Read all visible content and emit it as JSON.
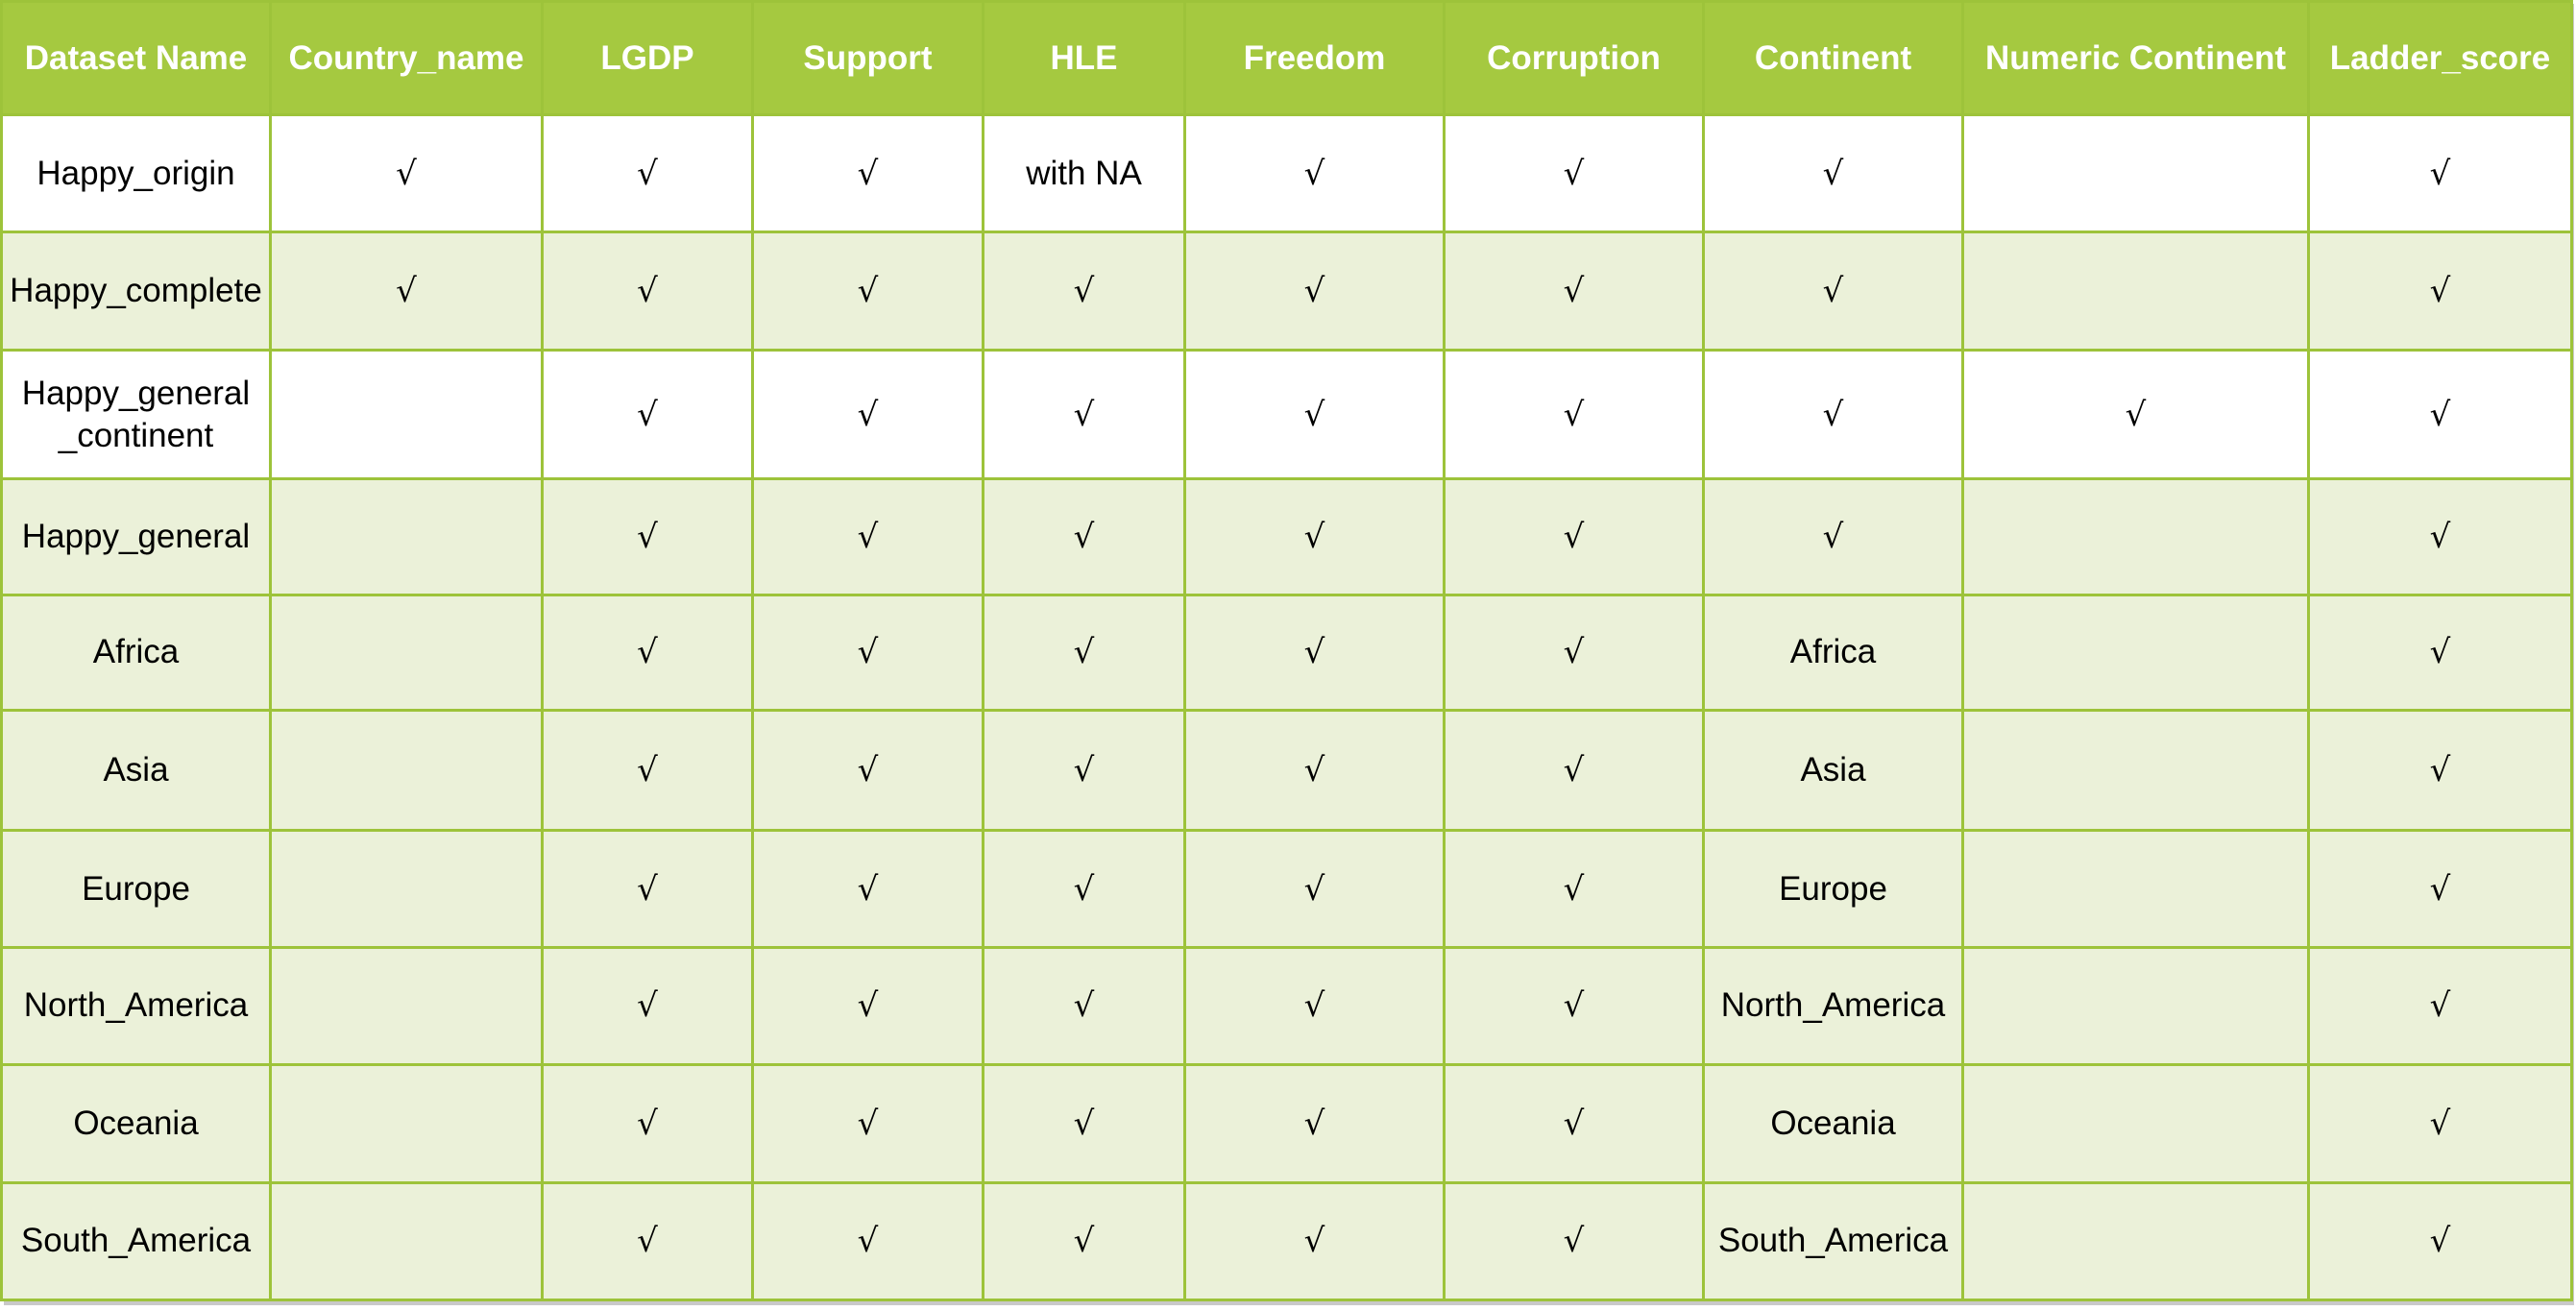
{
  "table": {
    "columns": [
      "Dataset Name",
      "Country_name",
      "LGDP",
      "Support",
      "HLE",
      "Freedom",
      "Corruption",
      "Continent",
      "Numeric Continent",
      "Ladder_score"
    ],
    "rows": [
      {
        "shade": "white",
        "cells": [
          "Happy_origin",
          "√",
          "√",
          "√",
          "with NA",
          "√",
          "√",
          "√",
          "",
          "√"
        ]
      },
      {
        "shade": "green",
        "cells": [
          "Happy_complete",
          "√",
          "√",
          "√",
          "√",
          "√",
          "√",
          "√",
          "",
          "√"
        ]
      },
      {
        "shade": "white",
        "cells": [
          "Happy_general\n_continent",
          "",
          "√",
          "√",
          "√",
          "√",
          "√",
          "√",
          "√",
          "√"
        ]
      },
      {
        "shade": "green",
        "cells": [
          "Happy_general",
          "",
          "√",
          "√",
          "√",
          "√",
          "√",
          "√",
          "",
          "√"
        ]
      },
      {
        "shade": "green",
        "cells": [
          "Africa",
          "",
          "√",
          "√",
          "√",
          "√",
          "√",
          "Africa",
          "",
          "√"
        ]
      },
      {
        "shade": "green",
        "cells": [
          "Asia",
          "",
          "√",
          "√",
          "√",
          "√",
          "√",
          "Asia",
          "",
          "√"
        ]
      },
      {
        "shade": "green",
        "cells": [
          "Europe",
          "",
          "√",
          "√",
          "√",
          "√",
          "√",
          "Europe",
          "",
          "√"
        ]
      },
      {
        "shade": "green",
        "cells": [
          "North_America",
          "",
          "√",
          "√",
          "√",
          "√",
          "√",
          "North_America",
          "",
          "√"
        ]
      },
      {
        "shade": "green",
        "cells": [
          "Oceania",
          "",
          "√",
          "√",
          "√",
          "√",
          "√",
          "Oceania",
          "",
          "√"
        ]
      },
      {
        "shade": "green",
        "cells": [
          "South_America",
          "",
          "√",
          "√",
          "√",
          "√",
          "√",
          "South_America",
          "",
          "√"
        ]
      }
    ]
  },
  "colors": {
    "header_bg": "#a5c940",
    "border": "#9dc33a",
    "row_green": "#ebf1d9",
    "row_white": "#ffffff"
  }
}
